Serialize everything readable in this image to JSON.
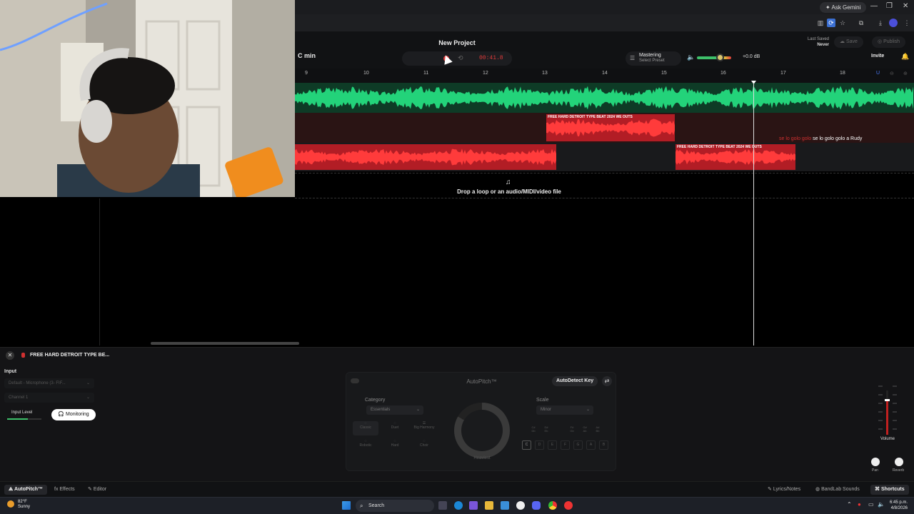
{
  "browser": {
    "ask_gemini": "Ask Gemini",
    "icons": [
      "bookmarks-icon",
      "sync-icon",
      "star-icon",
      "extensions-icon",
      "download-icon",
      "profile-icon",
      "more-icon"
    ]
  },
  "header": {
    "project_title": "New Project",
    "key": "C min",
    "time": "00:41.8",
    "mastering": "Mastering",
    "select_preset": "Select Preset",
    "volume_db": "+0.0 dB",
    "volume_level": 0.65,
    "last_saved_label": "Last Saved",
    "last_saved_value": "Never",
    "save": "Save",
    "publish": "Publish",
    "invite": "Invite"
  },
  "ruler": [
    "9",
    "10",
    "11",
    "12",
    "13",
    "14",
    "15",
    "16",
    "17",
    "18"
  ],
  "tracks": {
    "clip_label": "FREE HARD DETROIT TYPE BEAT 2024 WE OUTS",
    "lyric_red": "se lo golo golo",
    "lyric": "se lo golo golo a Rudy",
    "drop_text": "Drop a loop or an audio/MIDI/video file"
  },
  "panel": {
    "track_name": "FREE HARD DETROIT TYPE BE...",
    "input": "Input",
    "device": "Default - Microphone (3- FIF...",
    "channel": "Channel 1",
    "input_level": "Input Level",
    "monitoring": "Monitoring",
    "input_level_value": 0.6,
    "autopitch_title": "AutoPitch™",
    "autodetect": "AutoDetect Key",
    "category": "Category",
    "category_value": "Essentials",
    "scale": "Scale",
    "scale_value": "Minor",
    "effects_grid": [
      "Classic",
      "Duet",
      "Big Harmony",
      "Robotic",
      "Hard",
      "Choir"
    ],
    "knob_label": "Heaviest",
    "notes_row1": [
      "C#",
      "D#",
      "F#",
      "G#",
      "A#"
    ],
    "notes_row1_b": [
      "Db",
      "Eb",
      "Gb",
      "Ab",
      "Bb"
    ],
    "notes_row2": [
      "C",
      "D",
      "E",
      "F",
      "G",
      "A",
      "B"
    ],
    "volume": "Volume",
    "pan": "Pan",
    "reverb": "Reverb",
    "volume_fader": 0.8
  },
  "tabs": {
    "autopitch": "AutoPitch™",
    "effects": "Effects",
    "editor": "Editor",
    "lyrics": "Lyrics/Notes",
    "sounds": "BandLab Sounds",
    "shortcuts": "Shortcuts"
  },
  "taskbar": {
    "temp": "82°F",
    "weather": "Sunny",
    "search": "Search",
    "time": "6:45 p.m.",
    "date": "4/8/2026"
  }
}
